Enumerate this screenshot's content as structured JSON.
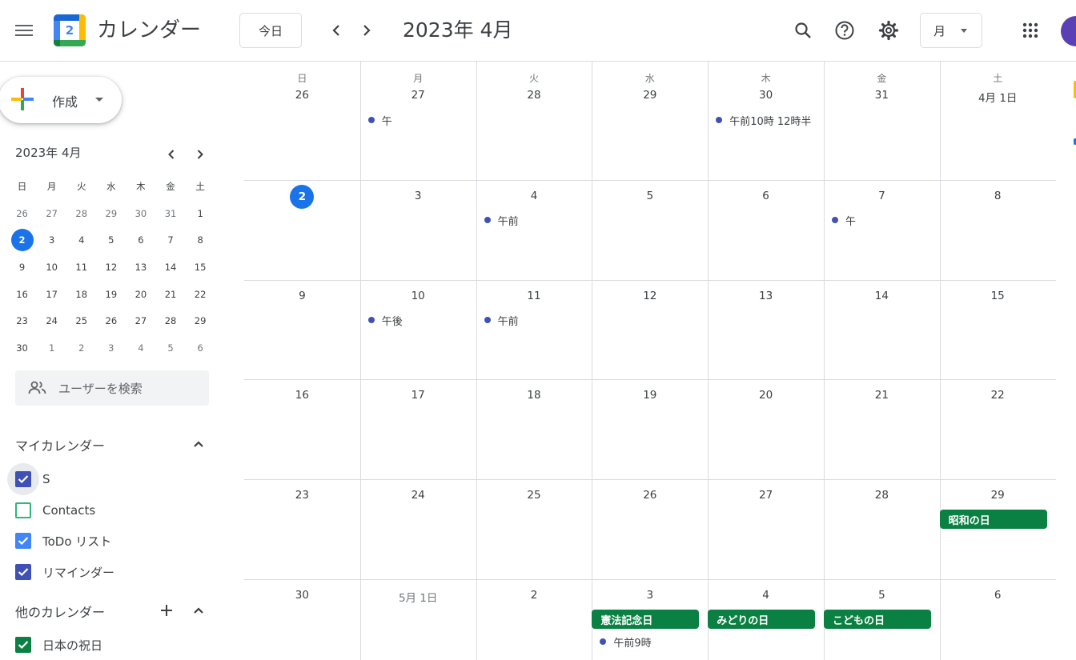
{
  "header": {
    "app_title": "カレンダー",
    "logo_number": "2",
    "today_label": "今日",
    "month_title": "2023年 4月",
    "view_label": "月"
  },
  "sidebar": {
    "create_label": "作成",
    "mini_cal": {
      "title": "2023年 4月",
      "weekdays": [
        "日",
        "月",
        "火",
        "水",
        "木",
        "金",
        "土"
      ],
      "weeks": [
        [
          "26",
          "27",
          "28",
          "29",
          "30",
          "31",
          "1"
        ],
        [
          "2",
          "3",
          "4",
          "5",
          "6",
          "7",
          "8"
        ],
        [
          "9",
          "10",
          "11",
          "12",
          "13",
          "14",
          "15"
        ],
        [
          "16",
          "17",
          "18",
          "19",
          "20",
          "21",
          "22"
        ],
        [
          "23",
          "24",
          "25",
          "26",
          "27",
          "28",
          "29"
        ],
        [
          "30",
          "1",
          "2",
          "3",
          "4",
          "5",
          "6"
        ]
      ]
    },
    "search_placeholder": "ユーザーを検索",
    "my_calendars_title": "マイカレンダー",
    "my_calendars": [
      {
        "label": "S",
        "color": "#3f51b5",
        "checked": true
      },
      {
        "label": "Contacts",
        "color": "#33b679",
        "checked": false
      },
      {
        "label": "ToDo リスト",
        "color": "#4285f4",
        "checked": true
      },
      {
        "label": "リマインダー",
        "color": "#3f51b5",
        "checked": true
      }
    ],
    "other_calendars_title": "他のカレンダー",
    "other_calendars": [
      {
        "label": "日本の祝日",
        "color": "#0b8043",
        "checked": true
      }
    ]
  },
  "grid": {
    "weekdays": [
      "日",
      "月",
      "火",
      "水",
      "木",
      "金",
      "土"
    ],
    "weeks": [
      [
        "26",
        "27",
        "28",
        "29",
        "30",
        "31",
        "4月 1日"
      ],
      [
        "2",
        "3",
        "4",
        "5",
        "6",
        "7",
        "8"
      ],
      [
        "9",
        "10",
        "11",
        "12",
        "13",
        "14",
        "15"
      ],
      [
        "16",
        "17",
        "18",
        "19",
        "20",
        "21",
        "22"
      ],
      [
        "23",
        "24",
        "25",
        "26",
        "27",
        "28",
        "29"
      ],
      [
        "30",
        "5月 1日",
        "2",
        "3",
        "4",
        "5",
        "6"
      ]
    ],
    "events": [
      {
        "week": 0,
        "day": 1,
        "text": "午"
      },
      {
        "week": 0,
        "day": 4,
        "text": "午前10時 12時半"
      },
      {
        "week": 1,
        "day": 2,
        "text": "午前"
      },
      {
        "week": 1,
        "day": 5,
        "text": "午"
      },
      {
        "week": 2,
        "day": 1,
        "text": "午後"
      },
      {
        "week": 2,
        "day": 2,
        "text": "午前"
      },
      {
        "week": 5,
        "day": 3,
        "text": "午前9時"
      }
    ],
    "holidays": [
      {
        "week": 4,
        "day": 6,
        "text": "昭和の日"
      },
      {
        "week": 5,
        "day": 3,
        "text": "憲法記念日"
      },
      {
        "week": 5,
        "day": 4,
        "text": "みどりの日"
      },
      {
        "week": 5,
        "day": 5,
        "text": "こどもの日"
      }
    ]
  },
  "colors": {
    "accent": "#1a73e8",
    "holiday": "#0b8043",
    "event_dot": "#3f51b5"
  }
}
